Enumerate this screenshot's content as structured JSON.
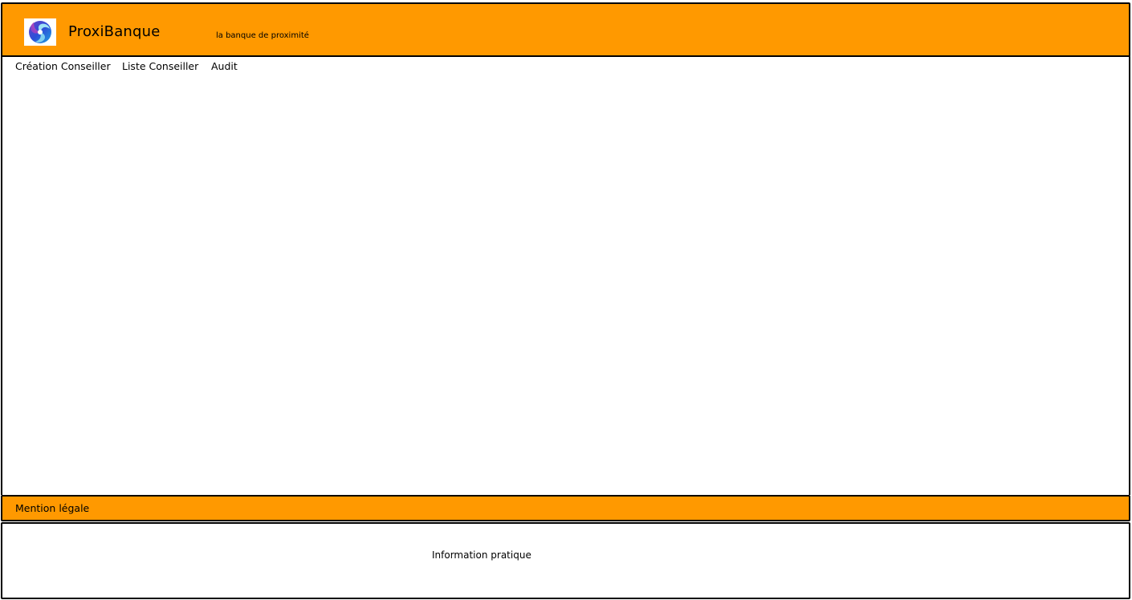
{
  "header": {
    "brand": "ProxiBanque",
    "tagline": "la banque de proximité",
    "logo_icon": "swirl-logo-icon",
    "background_color": "#ff9900"
  },
  "nav": {
    "items": [
      {
        "label": "Création Conseiller"
      },
      {
        "label": "Liste Conseiller"
      },
      {
        "label": "Audit"
      }
    ]
  },
  "legal": {
    "label": "Mention légale",
    "background_color": "#ff9900"
  },
  "footer": {
    "info": "Information pratique"
  }
}
